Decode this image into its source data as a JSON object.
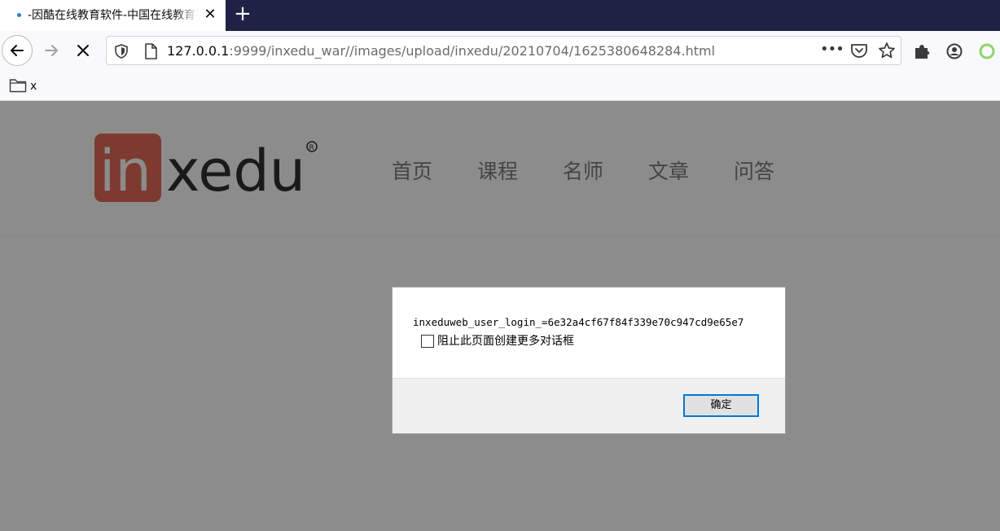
{
  "tab": {
    "title": "-因酷在线教育软件-中国在线教育平台",
    "close_glyph": "✕",
    "new_tab_glyph": "+"
  },
  "navbar": {
    "url_host": "127.0.0.1",
    "url_rest": ":9999/inxedu_war//images/upload/inxedu/20210704/1625380648284.html",
    "more_glyph": "•••"
  },
  "bookmarks": {
    "items": [
      {
        "label": "x",
        "icon": "folder-icon"
      }
    ]
  },
  "site": {
    "logo_text": "inxedu",
    "menu": [
      "首页",
      "课程",
      "名师",
      "文章",
      "问答"
    ],
    "colors": {
      "logo_red": "#b5452f",
      "logo_dark": "#111111"
    }
  },
  "dialog": {
    "message": "inxeduweb_user_login_=6e32a4cf67f84f339e70c947cd9e65e7",
    "checkbox_label": "阻止此页面创建更多对话框",
    "checkbox_checked": false,
    "ok_label": "确定"
  },
  "colors": {
    "tabstrip_bg": "#1f2244",
    "overlay_bg": "#8c8c8c",
    "focus_blue": "#0078d7"
  }
}
